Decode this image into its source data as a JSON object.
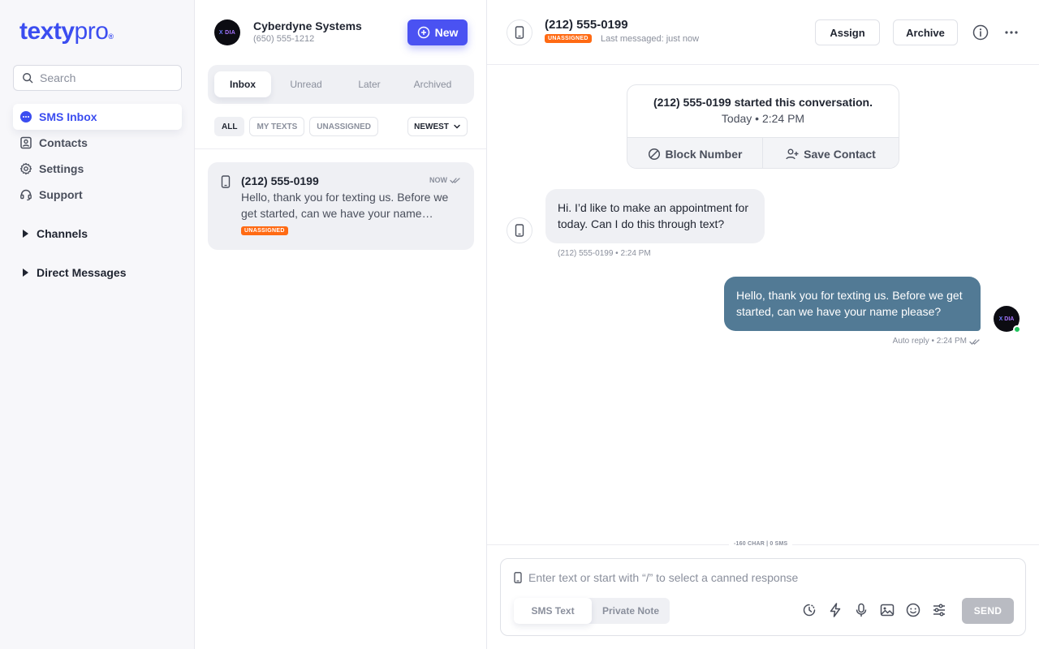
{
  "brand": {
    "logo_text_a": "texty",
    "logo_text_b": "pro",
    "logo_mark": "®",
    "accent": "#3b4df0"
  },
  "sidebar": {
    "search_placeholder": "Search",
    "items": [
      {
        "label": "SMS Inbox",
        "icon": "chat-bubble-icon",
        "active": true
      },
      {
        "label": "Contacts",
        "icon": "contact-card-icon",
        "active": false
      },
      {
        "label": "Settings",
        "icon": "gear-icon",
        "active": false
      },
      {
        "label": "Support",
        "icon": "headset-icon",
        "active": false
      }
    ],
    "sections": [
      {
        "label": "Channels"
      },
      {
        "label": "Direct Messages"
      }
    ]
  },
  "inbox": {
    "org_logo_a": "X",
    "org_logo_b": "DIA",
    "org_name": "Cyberdyne Systems",
    "org_phone": "(650) 555-1212",
    "new_label": "New",
    "tabs": [
      {
        "label": "Inbox",
        "active": true
      },
      {
        "label": "Unread",
        "active": false
      },
      {
        "label": "Later",
        "active": false
      },
      {
        "label": "Archived",
        "active": false
      }
    ],
    "filters": [
      {
        "label": "ALL",
        "active": true
      },
      {
        "label": "MY TEXTS",
        "active": false
      },
      {
        "label": "UNASSIGNED",
        "active": false
      }
    ],
    "sort_label": "NEWEST",
    "conversations": [
      {
        "number": "(212) 555-0199",
        "time": "NOW",
        "preview": "Hello, thank you for texting us. Before we get started, can we have your name…",
        "badge": "UNASSIGNED"
      }
    ]
  },
  "chat": {
    "header": {
      "number": "(212) 555-0199",
      "badge": "UNASSIGNED",
      "last_messaged": "Last messaged: just now",
      "assign_label": "Assign",
      "archive_label": "Archive"
    },
    "started_card": {
      "title": "(212) 555-0199 started this conversation.",
      "time": "Today • 2:24 PM",
      "block_label": "Block Number",
      "save_label": "Save Contact"
    },
    "messages": [
      {
        "direction": "in",
        "text": "Hi. I’d like to make an appointment for today. Can I do this through text?",
        "meta": "(212) 555-0199 • 2:24 PM"
      },
      {
        "direction": "out",
        "text": "Hello, thank you for texting us. Before we get started, can we have your name please?",
        "meta": "Auto reply • 2:24 PM"
      }
    ],
    "composer": {
      "counter": "-160 CHAR | 0 SMS",
      "placeholder": "Enter text or start with “/” to select a canned response",
      "modes": [
        {
          "label": "SMS Text",
          "active": true
        },
        {
          "label": "Private Note",
          "active": false
        }
      ],
      "send_label": "SEND"
    }
  }
}
